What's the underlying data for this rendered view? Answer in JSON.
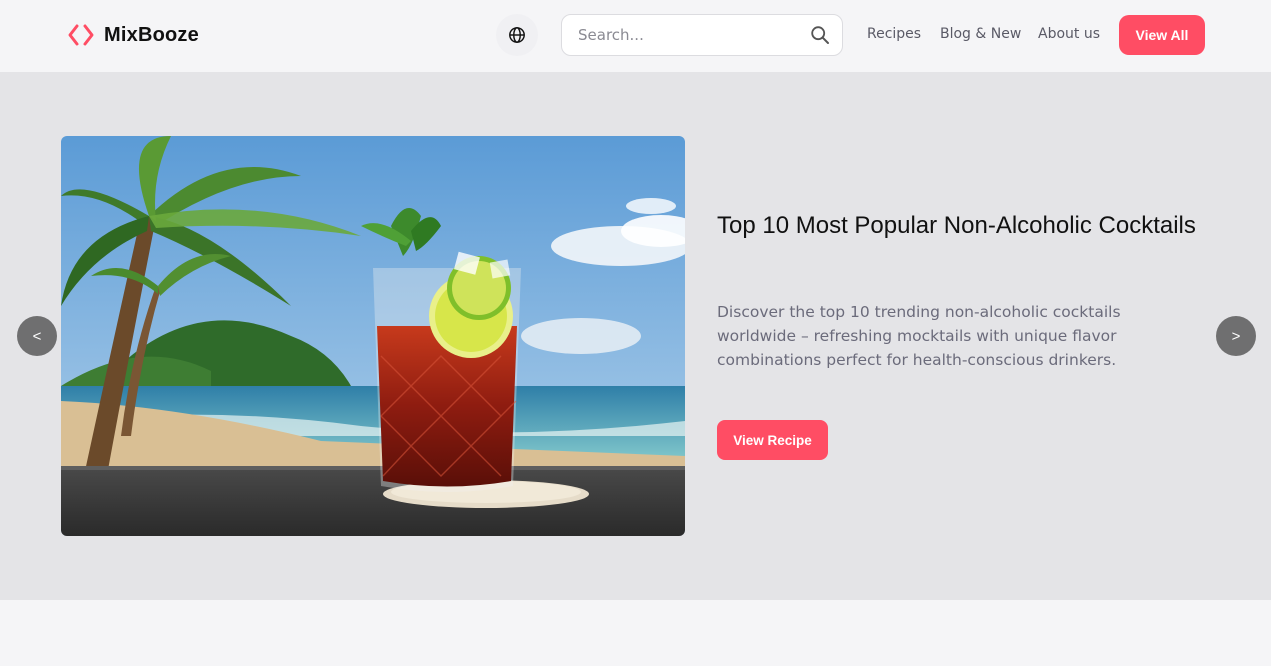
{
  "brand": {
    "name": "MixBooze",
    "accent_color": "#ff4d64",
    "logo_icon": "code-brackets-icon"
  },
  "header": {
    "language_icon": "globe-icon",
    "search": {
      "placeholder": "Search...",
      "value": "",
      "icon": "search-icon"
    },
    "nav": [
      {
        "label": "Recipes"
      },
      {
        "label": "Blog & New"
      },
      {
        "label": "About us"
      }
    ],
    "cta_label": "View All"
  },
  "hero": {
    "title": "Top 10 Most Popular Non-Alcoholic Cocktails",
    "description": "Discover the top 10 trending non-alcoholic cocktails worldwide – refreshing mocktails with unique flavor combinations perfect for health-conscious drinkers.",
    "button_label": "View Recipe",
    "prev_label": "<",
    "next_label": ">",
    "background_color": "#e4e4e7"
  }
}
